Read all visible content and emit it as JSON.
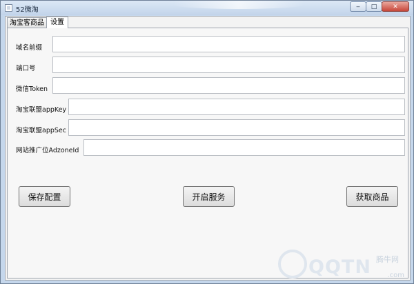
{
  "window": {
    "title": "52微淘"
  },
  "tabs": [
    {
      "label": "淘宝客商品"
    },
    {
      "label": "设置"
    }
  ],
  "settings": {
    "domain_prefix_label": "域名前缀",
    "port_label": "端口号",
    "wechat_token_label": "微信Token",
    "taobao_appkey_label": "淘宝联盟appKey",
    "taobao_appsec_label": "淘宝联盟appSec",
    "adzone_label": "网站推广位AdzoneId",
    "domain_prefix_value": "",
    "port_value": "",
    "wechat_token_value": "",
    "taobao_appkey_value": "",
    "taobao_appsec_value": "",
    "adzone_value": ""
  },
  "actions": {
    "save_label": "保存配置",
    "start_label": "开启服务",
    "fetch_label": "获取商品"
  },
  "watermark": {
    "brand": "QQTN",
    "suffix": ".com",
    "site_name": "腾牛网"
  }
}
